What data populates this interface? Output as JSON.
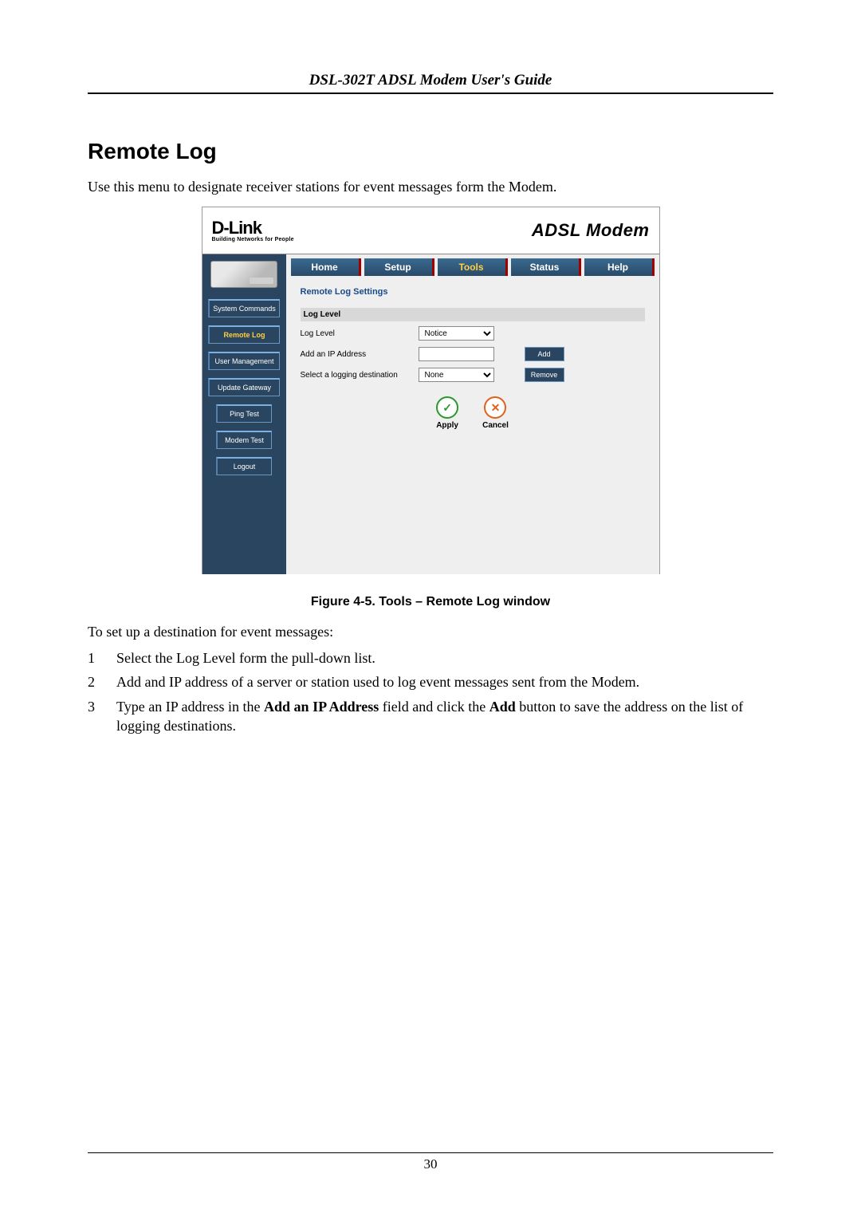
{
  "doc_header": "DSL-302T ADSL Modem User's Guide",
  "section_title": "Remote Log",
  "intro": "Use this menu to designate receiver stations for event messages form the Modem.",
  "ui": {
    "logo_main": "D-Link",
    "logo_sub": "Building Networks for People",
    "product_title": "ADSL Modem",
    "tabs": {
      "home": "Home",
      "setup": "Setup",
      "tools": "Tools",
      "status": "Status",
      "help": "Help"
    },
    "sidebar": {
      "system_commands": "System Commands",
      "remote_log": "Remote Log",
      "user_management": "User Management",
      "update_gateway": "Update Gateway",
      "ping_test": "Ping Test",
      "modem_test": "Modem Test",
      "logout": "Logout"
    },
    "panel": {
      "title": "Remote Log Settings",
      "group_header": "Log Level",
      "log_level_label": "Log Level",
      "log_level_value": "Notice",
      "add_ip_label": "Add an IP Address",
      "add_ip_value": "",
      "add_btn": "Add",
      "dest_label": "Select a logging destination",
      "dest_value": "None",
      "remove_btn": "Remove",
      "apply_label": "Apply",
      "cancel_label": "Cancel"
    }
  },
  "figure_caption": "Figure 4-5. Tools – Remote Log window",
  "post_text": "To set up a destination for event messages:",
  "steps": [
    {
      "n": "1",
      "t": "Select the Log Level form the pull-down list."
    },
    {
      "n": "2",
      "t": "Add and IP address of a server or station used to log event messages sent from the Modem."
    },
    {
      "n": "3",
      "pre": "Type an IP address in the ",
      "b1": "Add an IP Address",
      "mid": " field and click the ",
      "b2": "Add",
      "post": " button to save the address on the list of logging destinations."
    }
  ],
  "page_number": "30"
}
